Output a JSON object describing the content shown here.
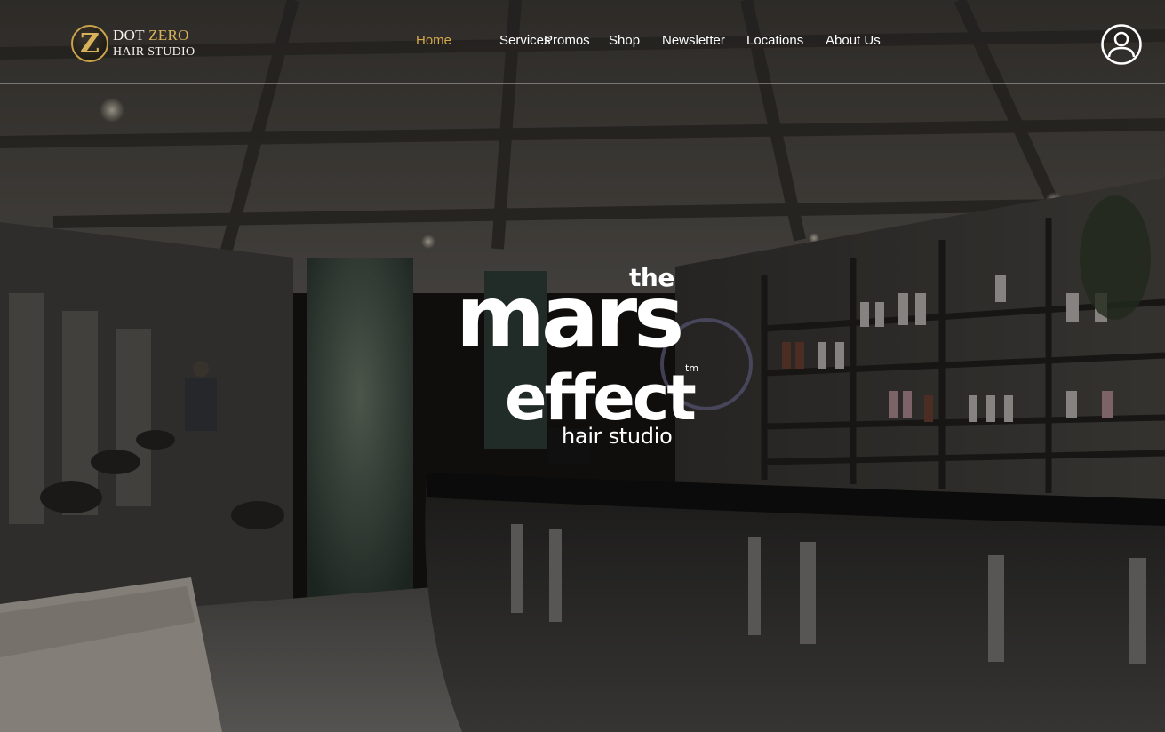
{
  "colors": {
    "accent_gold": "#d4a84b",
    "nav_text": "#ffffff",
    "header_rule": "#8c8c8c"
  },
  "logo": {
    "mark": "Z",
    "line1_a": "DOT",
    "line1_b": "ZERO",
    "line2": "HAIR STUDIO"
  },
  "nav": {
    "items": [
      {
        "label": "Home",
        "active": true
      },
      {
        "label": "Services",
        "active": false
      },
      {
        "label": "Promos",
        "active": false
      },
      {
        "label": "Shop",
        "active": false
      },
      {
        "label": "Newsletter",
        "active": false
      },
      {
        "label": "Locations",
        "active": false
      },
      {
        "label": "About Us",
        "active": false
      }
    ]
  },
  "account": {
    "icon": "user-account-icon"
  },
  "hero": {
    "background": "salon-interior-photo",
    "brand": {
      "the": "the",
      "mars": "mars",
      "tm": "tm",
      "effect": "effect",
      "subtitle": "hair studio"
    }
  }
}
